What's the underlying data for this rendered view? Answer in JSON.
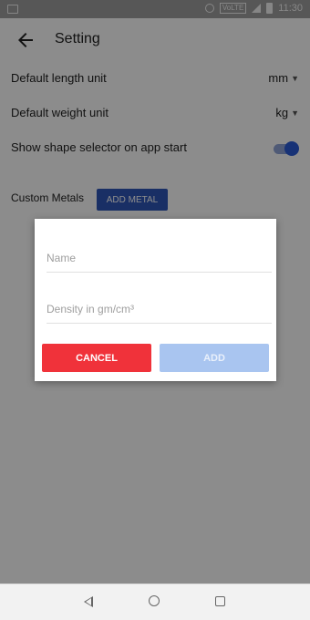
{
  "statusbar": {
    "volte": "VoLTE",
    "time": "11:30"
  },
  "appbar": {
    "title": "Setting"
  },
  "settings": {
    "length_label": "Default length unit",
    "length_value": "mm",
    "weight_label": "Default weight unit",
    "weight_value": "kg",
    "shape_selector_label": "Show shape selector on app start",
    "shape_selector_on": true
  },
  "custom_metals": {
    "label": "Custom Metals",
    "add_button": "ADD METAL"
  },
  "dialog": {
    "name_placeholder": "Name",
    "density_placeholder": "Density in gm/cm³",
    "cancel_label": "CANCEL",
    "add_label": "ADD"
  },
  "colors": {
    "accent": "#2a5bd7",
    "cancel": "#f0323a",
    "add_disabled": "#a9c5f0"
  },
  "icons": {
    "back": "arrow-left",
    "dropdown": "caret-down",
    "nav_back": "triangle-left",
    "nav_home": "circle",
    "nav_recent": "square"
  }
}
